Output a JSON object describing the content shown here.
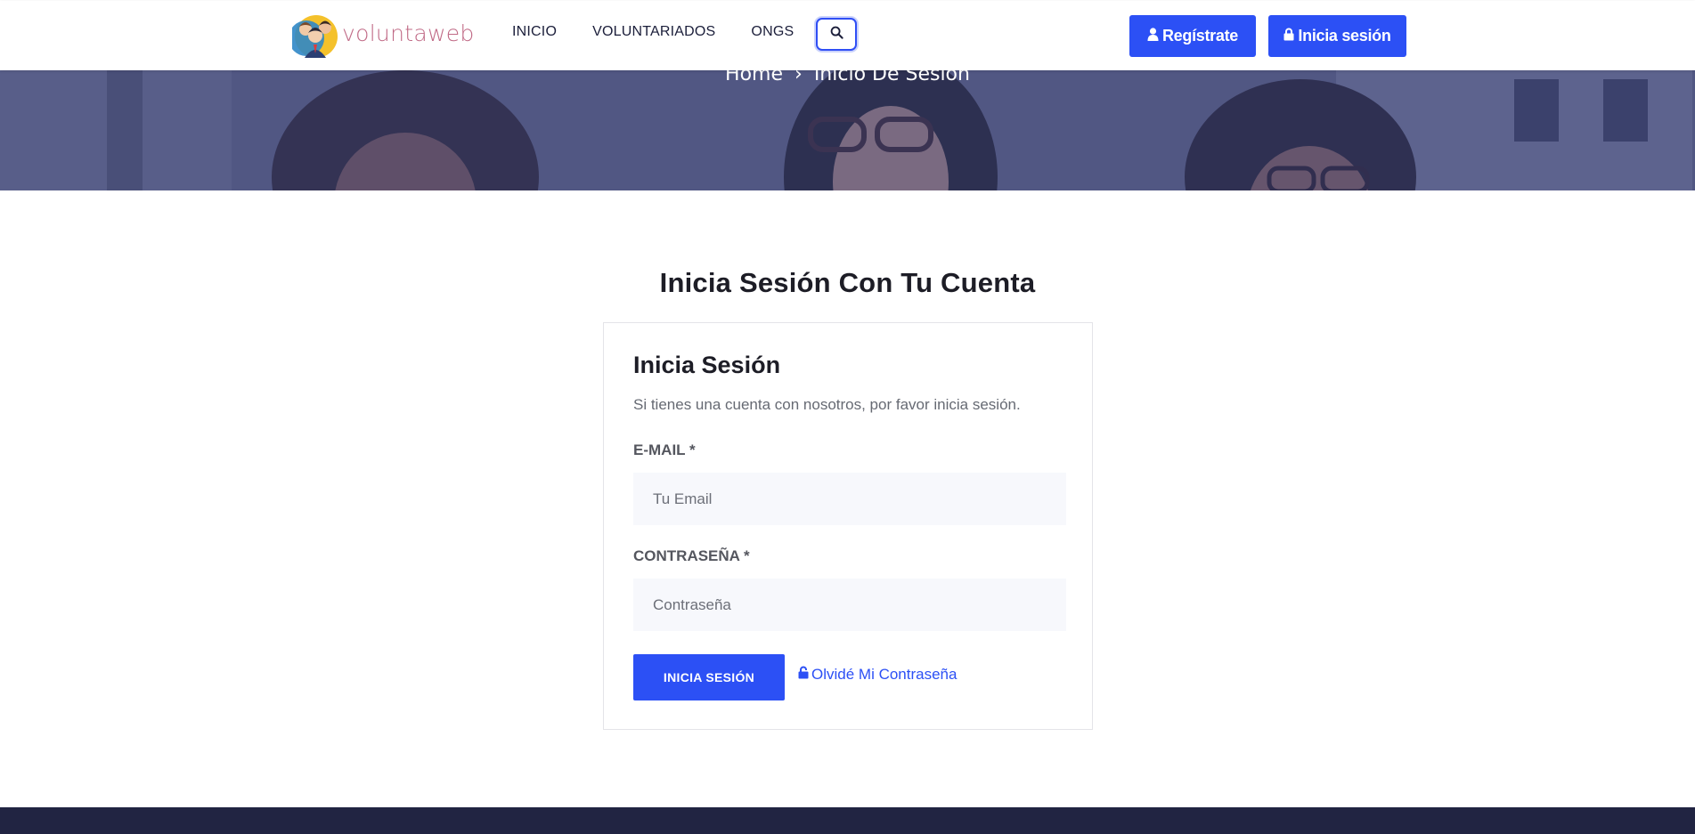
{
  "header": {
    "logo_text": "voluntaweb",
    "nav": [
      "INICIO",
      "VOLUNTARIADOS",
      "ONGS"
    ],
    "register_label": "Regístrate",
    "login_label": "Inicia sesión"
  },
  "hero": {
    "breadcrumb_home": "Home",
    "breadcrumb_separator": "›",
    "breadcrumb_current": "Inicio De Sesion"
  },
  "main": {
    "page_title": "Inicia Sesión Con Tu Cuenta",
    "card_title": "Inicia Sesión",
    "card_subtitle": "Si tienes una cuenta con nosotros, por favor inicia sesión.",
    "email_label": "E-MAIL *",
    "email_placeholder": "Tu Email",
    "password_label": "CONTRASEÑA *",
    "password_placeholder": "Contraseña",
    "submit_label": "INICIA SESIÓN",
    "forgot_label": "Olvidé Mi Contraseña"
  },
  "colors": {
    "accent": "#2c50f5",
    "footer": "#212442",
    "logo_text": "#c06a86"
  },
  "icons": {
    "search": "search-icon",
    "user": "user-icon",
    "lock": "lock-icon",
    "unlock": "unlock-icon"
  }
}
